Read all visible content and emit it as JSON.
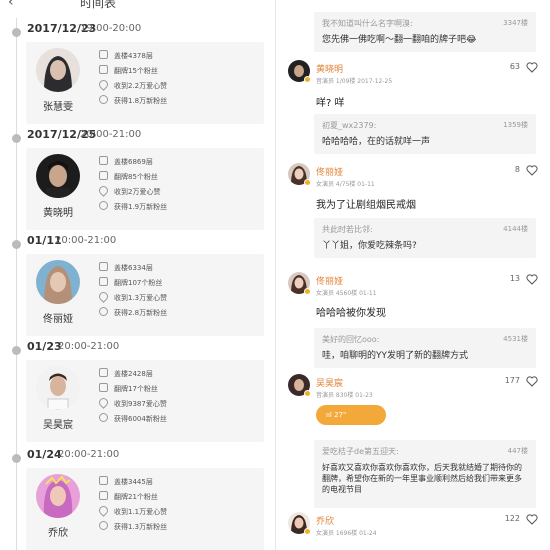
{
  "header": {
    "back_icon": "chevron-left-icon",
    "title": "时间表"
  },
  "sections": [
    {
      "date": "2017/12/23",
      "time": "19:00-20:00",
      "name": "张慧雯",
      "floor": "盖楼4378层",
      "flip": "翻牌15个粉丝",
      "likes": "收到2.2万爱心赞",
      "fans": "获得1.8万新粉丝",
      "avatar_colors": [
        "#2b2b30",
        "#d9c0b0"
      ]
    },
    {
      "date": "2017/12/25",
      "time": "20:00-21:00",
      "name": "黄晓明",
      "floor": "盖楼6869层",
      "flip": "翻牌85个粉丝",
      "likes": "收到2万爱心赞",
      "fans": "获得1.9万新粉丝",
      "avatar_colors": [
        "#1c1c1c",
        "#c9a58c"
      ]
    },
    {
      "date": "01/11",
      "time": "20:00-21:00",
      "name": "佟丽娅",
      "floor": "盖楼6334层",
      "flip": "翻牌107个粉丝",
      "likes": "收到1.3万爱心赞",
      "fans": "获得2.8万新粉丝",
      "avatar_colors": [
        "#7fb2d0",
        "#e4c8b4"
      ]
    },
    {
      "date": "01/23",
      "time": "20:00-21:00",
      "name": "吴昊宸",
      "floor": "盖楼2428层",
      "flip": "翻牌17个粉丝",
      "likes": "收到9387爱心赞",
      "fans": "获得6004新粉丝",
      "avatar_colors": [
        "#f2f2f2",
        "#3a2a22"
      ]
    },
    {
      "date": "01/24",
      "time": "20:00-21:00",
      "name": "乔欣",
      "floor": "盖楼3445层",
      "flip": "翻牌21个粉丝",
      "likes": "收到1.1万爱心赞",
      "fans": "获得1.3万新粉丝",
      "avatar_colors": [
        "#c86ac0",
        "#f0c8b8"
      ]
    }
  ],
  "comments": {
    "q1": {
      "name": "我不知道叫什么名字啊溴:",
      "floor": "3347楼",
      "text": "您先佛一佛吃啊～翻一翻咱的牌子吧😂"
    },
    "c1": {
      "name": "黄晓明",
      "meta": "音演员   1/09楼   2017-12-25",
      "likes": "63",
      "text": "咩? 咩"
    },
    "q2": {
      "name": "初夏_wx2379:",
      "floor": "1359楼",
      "text": "哈哈哈哈，在的话就咩一声"
    },
    "c2": {
      "name": "佟丽娅",
      "meta": "女演员   4/75楼   01-11",
      "likes": "8",
      "text": "我为了让剧组烟民戒烟"
    },
    "q3": {
      "name": "共此时若比邻:",
      "floor": "4144楼",
      "text": "丫丫姐，你爱吃辣条吗?"
    },
    "c3": {
      "name": "佟丽娅",
      "meta": "女演员   4560楼   01-11",
      "likes": "13",
      "text": "哈哈哈被你发现"
    },
    "q4": {
      "name": "美好的回忆ooo:",
      "floor": "4531楼",
      "text": "哇，咱聊明的YY发明了新的翻牌方式"
    },
    "c4": {
      "name": "吴昊宸",
      "meta": "音演员   830楼   01-23",
      "likes": "177",
      "voice": "27\""
    },
    "q5": {
      "name": "爱吃桔子de第五迎天:",
      "floor": "447楼",
      "text": "好喜欢又喜欢你喜欢你喜欢你，后天我就结婚了期待你的翻牌，希望你在新的一年里事业顺利然后给我们带来更多的电视节目"
    },
    "c5": {
      "name": "乔欣",
      "meta": "女演员   1696楼   01-24",
      "likes": "122"
    }
  },
  "colors": {
    "accent": "#e0843a",
    "voice_bg": "#f2a93a",
    "card_bg": "#f5f5f5"
  }
}
